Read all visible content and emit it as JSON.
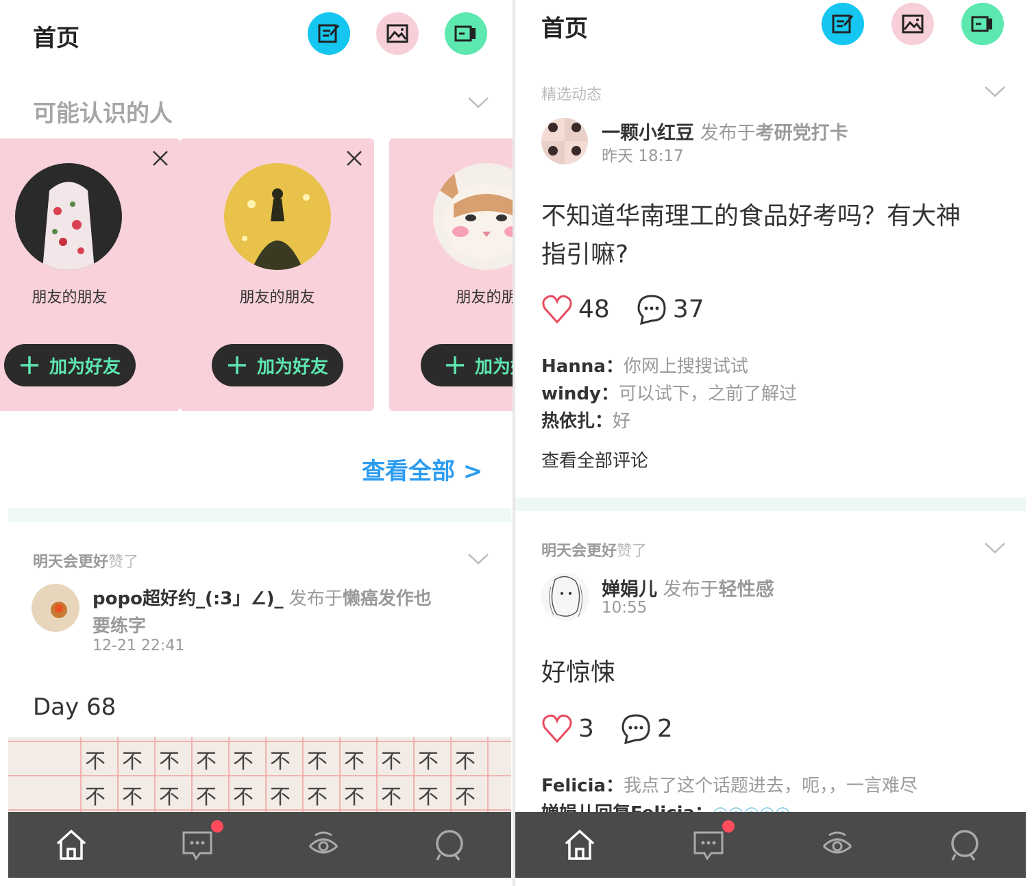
{
  "left": {
    "header": {
      "title": "首页"
    },
    "people_section": {
      "title": "可能认识的人"
    },
    "cards": [
      {
        "subtitle": "朋友的朋友",
        "add_label": "加为好友"
      },
      {
        "subtitle": "朋友的朋友",
        "add_label": "加为好友"
      },
      {
        "subtitle": "朋友的朋",
        "add_label": "加为好"
      }
    ],
    "view_all": "查看全部 >",
    "post": {
      "liker": "明天会更好",
      "liked_suffix": "赞了",
      "author": "popo超好约_(:3」∠)_",
      "published_prefix": "发布于",
      "topic_line1": "懒癌发作也",
      "topic_line2": "要练字",
      "time": "12-21 22:41",
      "content": "Day 68",
      "image_chars": [
        "不",
        "不",
        "不",
        "不",
        "不",
        "不",
        "不",
        "不",
        "不",
        "不",
        "不"
      ]
    }
  },
  "right": {
    "header": {
      "title": "首页"
    },
    "post1": {
      "section": "精选动态",
      "author": "一颗小红豆",
      "published_prefix": "发布于",
      "topic": "考研党打卡",
      "time": "昨天 18:17",
      "content_line1": "不知道华南理工的食品好考吗？有大神",
      "content_line2": "指引嘛?",
      "likes": "48",
      "comments": "37",
      "comment_list": [
        {
          "who": "Hanna：",
          "text": "你网上搜搜试试"
        },
        {
          "who": "windy：",
          "text": "可以试下，之前了解过"
        },
        {
          "who": "热依扎：",
          "text": "好"
        }
      ],
      "view_all_comments": "查看全部评论"
    },
    "post2": {
      "liker": "明天会更好",
      "liked_suffix": "赞了",
      "author": "婵娟儿",
      "published_prefix": "发布于",
      "topic": "轻性感",
      "time": "10:55",
      "content": "好惊悚",
      "likes": "3",
      "comments": "2",
      "comment_list": [
        {
          "who": "Felicia：",
          "text": "我点了这个话题进去，呃，，一言难尽"
        },
        {
          "who": "婵娟儿回复Felicia：",
          "text": "◎◎◎◎◎"
        }
      ]
    }
  },
  "tabbar_icons": [
    "home-icon",
    "message-icon",
    "explore-eye-icon",
    "search-icon"
  ],
  "colors": {
    "accent_blue": "#15c6f0",
    "accent_pink": "#f7cfd8",
    "accent_green": "#5de8b0",
    "card_pink": "#f9d1db",
    "tabbar": "#4a4a4a",
    "link_blue": "#2c9cf0",
    "badge_red": "#ff4b5c"
  }
}
